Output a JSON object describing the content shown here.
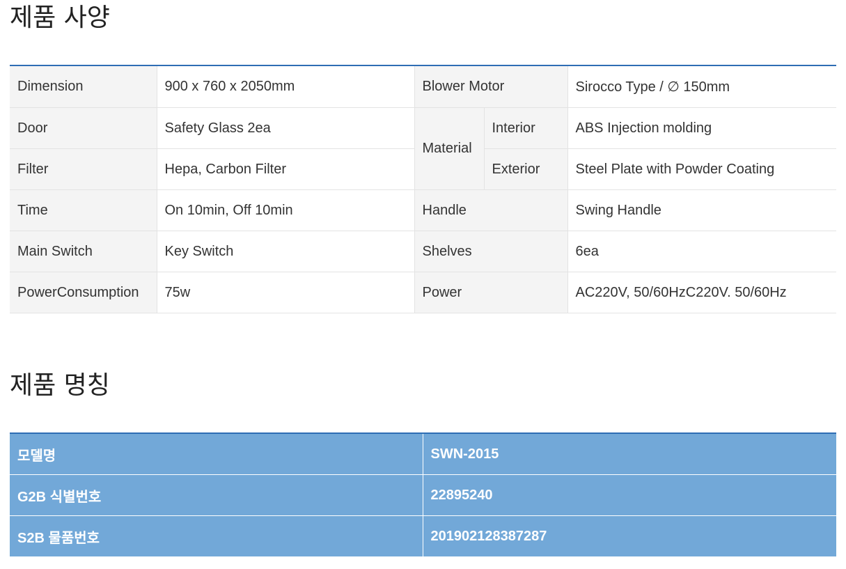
{
  "spec_section": {
    "title": "제품 사양",
    "rows": {
      "dimension": {
        "label": "Dimension",
        "value": "900 x 760 x 2050mm"
      },
      "blower_motor": {
        "label": "Blower Motor",
        "value": "Sirocco Type / ∅ 150mm"
      },
      "door": {
        "label": "Door",
        "value": "Safety Glass 2ea"
      },
      "material": {
        "label": "Material",
        "interior_label": "Interior",
        "interior_value": "ABS Injection molding",
        "exterior_label": "Exterior",
        "exterior_value": "Steel Plate with Powder Coating"
      },
      "filter": {
        "label": "Filter",
        "value": "Hepa, Carbon Filter"
      },
      "time": {
        "label": "Time",
        "value": "On 10min, Off 10min"
      },
      "handle": {
        "label": "Handle",
        "value": "Swing Handle"
      },
      "main_switch": {
        "label": "Main Switch",
        "value": "Key Switch"
      },
      "shelves": {
        "label": "Shelves",
        "value": "6ea"
      },
      "power_consumption": {
        "label": "PowerConsumption",
        "value": "75w"
      },
      "power": {
        "label": "Power",
        "value": "AC220V, 50/60HzC220V. 50/60Hz"
      }
    }
  },
  "name_section": {
    "title": "제품 명칭",
    "rows": [
      {
        "label": "모델명",
        "value": "SWN-2015"
      },
      {
        "label": "G2B 식별번호",
        "value": "22895240"
      },
      {
        "label": "S2B 물품번호",
        "value": "201902128387287"
      }
    ]
  },
  "colors": {
    "accent_line": "#2e6db4",
    "name_table_bg": "#72a8d8",
    "spec_label_bg": "#f4f4f4"
  }
}
